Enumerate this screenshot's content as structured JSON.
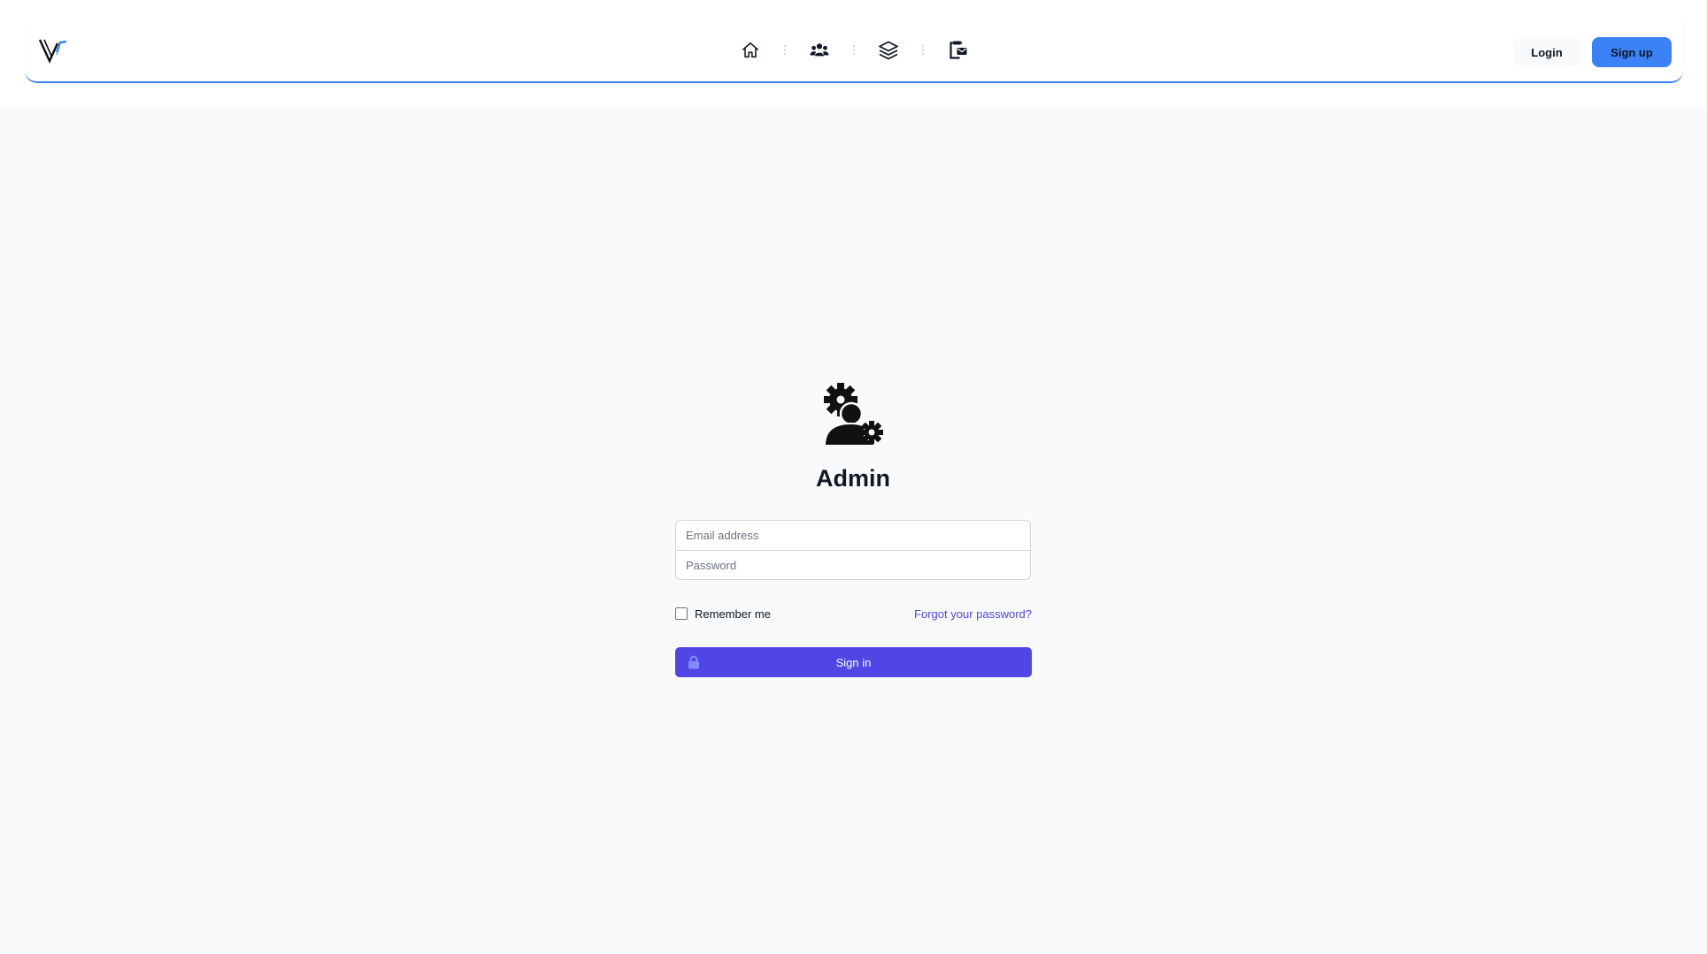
{
  "header": {
    "logo_icon": "v-logo-icon",
    "nav_icons": [
      "home-icon",
      "users-icon",
      "layers-icon",
      "clipboard-mail-icon"
    ],
    "login_label": "Login",
    "signup_label": "Sign up",
    "accent_color": "#3b82f6"
  },
  "main": {
    "icon": "user-gears-icon",
    "title": "Admin",
    "email_placeholder": "Email address",
    "password_placeholder": "Password",
    "remember_label": "Remember me",
    "forgot_label": "Forgot your password?",
    "signin_label": "Sign in",
    "signin_icon": "lock-icon",
    "primary_color": "#4f46e5"
  }
}
